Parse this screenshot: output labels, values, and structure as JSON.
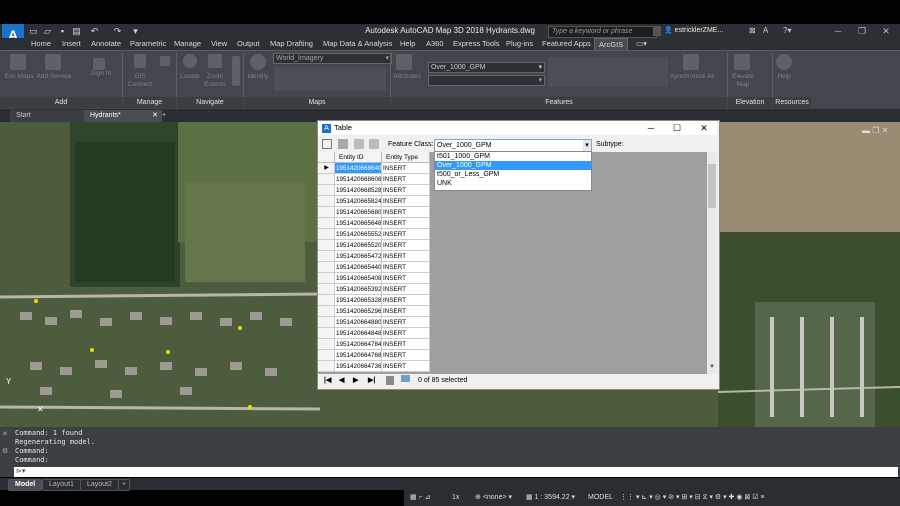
{
  "app": {
    "logo": "A",
    "title": "Autodesk AutoCAD Map 3D 2018    Hydrants.dwg",
    "search_placeholder": "Type a keyword or phrase",
    "user": "estricklerZME..."
  },
  "menu": [
    "Home",
    "Insert",
    "Annotate",
    "Parametric",
    "Manage",
    "View",
    "Output",
    "Map Drafting",
    "Map Data & Analysis",
    "Help",
    "A360",
    "Express Tools",
    "Plug-ins",
    "Featured Apps",
    "ArcGIS"
  ],
  "ribbon": {
    "panels": [
      "Add",
      "Manage",
      "Navigate",
      "Maps",
      "Features",
      "Elevation",
      "Resources"
    ],
    "buttons": [
      "Esri Maps",
      "Add Service",
      "Sign In",
      "GIS Connect",
      "Locate",
      "Zoom Extents",
      "Identify",
      "Attributes",
      "Synchronize All",
      "Elevate Map",
      "Help"
    ],
    "basemap_value": "World_Imagery",
    "feature_value": "Over_1000_GPM"
  },
  "filetabs": [
    "Start",
    "Hydrants*"
  ],
  "dialog": {
    "title": "Table",
    "feature_class_label": "Feature Class:",
    "feature_class_value": "Over_1000_GPM",
    "subtype_label": "Subtype:",
    "dropdown_options": [
      "t501_1000_GPM",
      "Over_1000_GPM",
      "t500_or_Less_GPM",
      "UNK"
    ],
    "dropdown_selected_index": 1,
    "columns": [
      "Entity ID",
      "Entity Type"
    ],
    "rows": [
      [
        "1951420668640",
        "INSERT"
      ],
      [
        "1951420668608",
        "INSERT"
      ],
      [
        "1951420668528",
        "INSERT"
      ],
      [
        "1951420665824",
        "INSERT"
      ],
      [
        "1951420665680",
        "INSERT"
      ],
      [
        "1951420665648",
        "INSERT"
      ],
      [
        "1951420665552",
        "INSERT"
      ],
      [
        "1951420665520",
        "INSERT"
      ],
      [
        "1951420665472",
        "INSERT"
      ],
      [
        "1951420665440",
        "INSERT"
      ],
      [
        "1951420665408",
        "INSERT"
      ],
      [
        "1951420665392",
        "INSERT"
      ],
      [
        "1951420665328",
        "INSERT"
      ],
      [
        "1951420665296",
        "INSERT"
      ],
      [
        "1951420664880",
        "INSERT"
      ],
      [
        "1951420664848",
        "INSERT"
      ],
      [
        "1951420664784",
        "INSERT"
      ],
      [
        "1951420664768",
        "INSERT"
      ],
      [
        "1951420664736",
        "INSERT"
      ]
    ],
    "selection_status": "0 of 85 selected"
  },
  "command": {
    "history": [
      "Command:  1 found",
      "Regenerating model.",
      "Command:",
      "Command:"
    ],
    "prompt": ""
  },
  "layout_tabs": [
    "Model",
    "Layout1",
    "Layout2"
  ],
  "status": {
    "scale": "1 : 3594.22",
    "mode": "MODEL",
    "none_label": "<none>",
    "snap": "1x"
  },
  "colors": {
    "accent": "#1a73c8",
    "selection": "#3399ff",
    "ribbon": "#43474d"
  }
}
